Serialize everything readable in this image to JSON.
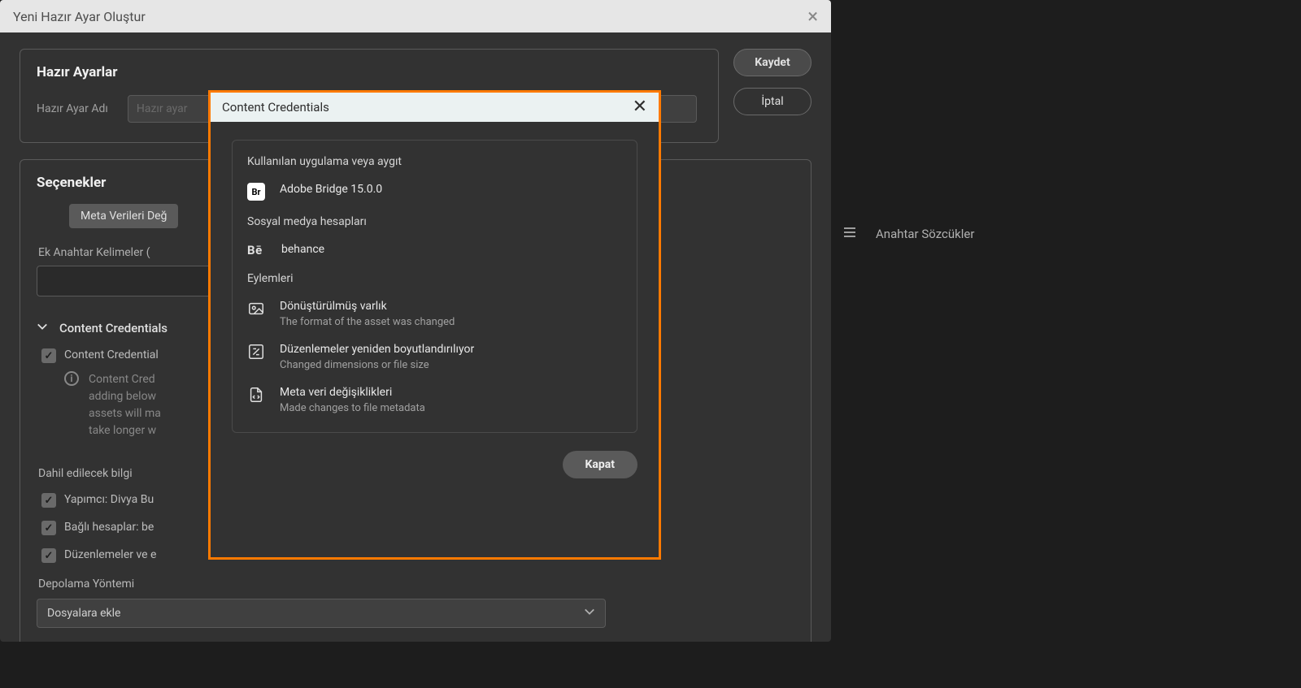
{
  "bg": {
    "title": "Yeni Hazır Ayar Oluştur",
    "presets": {
      "legend": "Hazır Ayarlar",
      "nameLabel": "Hazır Ayar Adı",
      "placeholder": "Hazır ayar"
    },
    "buttons": {
      "save": "Kaydet",
      "cancel": "İptal"
    },
    "options": {
      "legend": "Seçenekler",
      "metaChip": "Meta Verileri Değ",
      "extraLabel": "Ek Anahtar Kelimeler (",
      "cc": {
        "heading": "Content Credentials",
        "apply": "Content Credential",
        "info1": "Content Cred",
        "info2": "adding below",
        "info3": "assets will ma",
        "info4": "take longer w",
        "include": "Dahil edilecek bilgi",
        "producer": "Yapımcı: Divya Bu",
        "linked": "Bağlı hesaplar: be",
        "edits": "Düzenlemeler ve e",
        "storage": "Depolama Yöntemi",
        "storageSel": "Dosyalara ekle"
      }
    }
  },
  "right": {
    "keywords": "Anahtar Sözcükler"
  },
  "modal": {
    "title": "Content Credentials",
    "usedApp": {
      "label": "Kullanılan uygulama veya aygıt",
      "app": "Adobe Bridge 15.0.0"
    },
    "social": {
      "label": "Sosyal medya hesapları",
      "behance": "behance"
    },
    "actions": {
      "label": "Eylemleri",
      "a1": {
        "t": "Dönüştürülmüş varlık",
        "d": "The format of the asset was changed"
      },
      "a2": {
        "t": "Düzenlemeler yeniden boyutlandırılıyor",
        "d": "Changed dimensions or file size"
      },
      "a3": {
        "t": "Meta veri değişiklikleri",
        "d": "Made changes to file metadata"
      }
    },
    "close": "Kapat"
  }
}
